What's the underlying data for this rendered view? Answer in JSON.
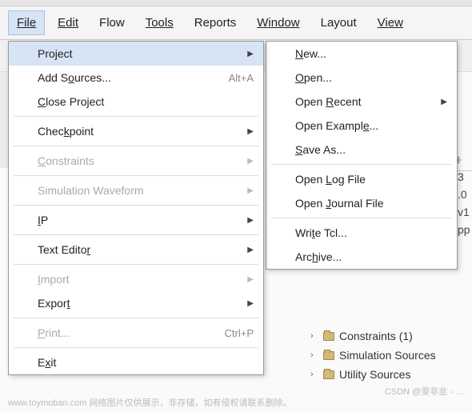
{
  "menubar": {
    "file": "File",
    "edit": "Edit",
    "flow": "Flow",
    "tools": "Tools",
    "reports": "Reports",
    "window": "Window",
    "layout": "Layout",
    "view": "View"
  },
  "fileMenu": {
    "project": "Project",
    "addSources": "Add Sources...",
    "addSourcesKey": "Alt+A",
    "closeProject": "Close Project",
    "checkpoint": "Checkpoint",
    "constraints": "Constraints",
    "simWaveform": "Simulation Waveform",
    "ip": "IP",
    "textEditor": "Text Editor",
    "import": "Import",
    "export": "Export",
    "print": "Print...",
    "printKey": "Ctrl+P",
    "exit": "Exit"
  },
  "projectSubmenu": {
    "new": "New...",
    "open": "Open...",
    "openRecent": "Open Recent",
    "openExample": "Open Example...",
    "saveAs": "Save As...",
    "openLog": "Open Log File",
    "openJournal": "Open Journal File",
    "writeTcl": "Write Tcl...",
    "archive": "Archive..."
  },
  "tree": {
    "constraints": "Constraints (1)",
    "simSources": "Simulation Sources",
    "utilSources": "Utility Sources"
  },
  "sideChars": {
    "c0": "3",
    "c1": ".0",
    "c2": "v1",
    "c3": "pp"
  },
  "watermark": {
    "left": "www.toymoban.com 网络图片仅供展示，非存储，如有侵权请联系删除。",
    "right": "CSDN @斐非韭 - …"
  }
}
